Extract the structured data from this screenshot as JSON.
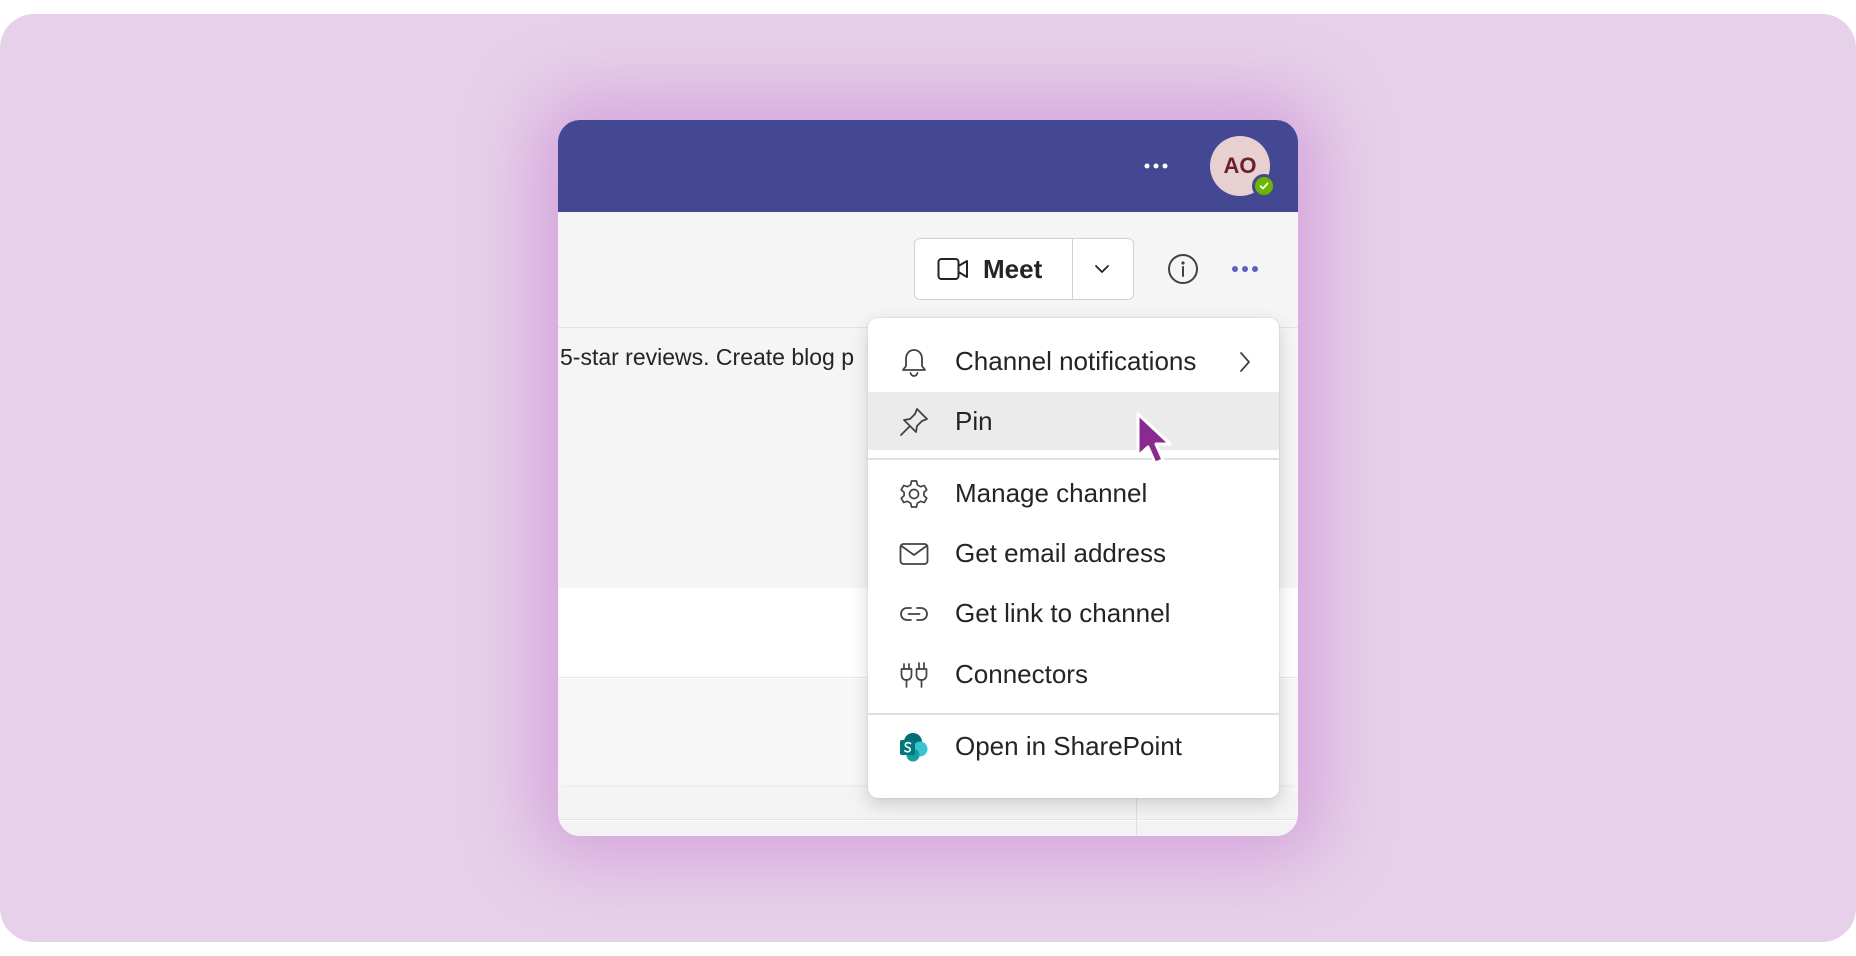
{
  "titlebar": {
    "more_icon": "more-horizontal-icon",
    "avatar_initials": "AO",
    "presence_status": "available",
    "colors": {
      "brand": "#444791",
      "presence": "#6bb700"
    }
  },
  "header": {
    "meet_label": "Meet",
    "meet_icon": "video-camera-icon",
    "dropdown_icon": "chevron-down-icon",
    "info_icon": "info-icon",
    "more_icon": "more-horizontal-icon"
  },
  "message": {
    "text": "5-star reviews. Create blog p"
  },
  "menu": {
    "items": [
      {
        "label": "Channel notifications",
        "icon": "bell-icon",
        "has_submenu": true
      },
      {
        "label": "Pin",
        "icon": "pin-icon",
        "hovered": true
      },
      {
        "label": "Manage channel",
        "icon": "gear-icon"
      },
      {
        "label": "Get email address",
        "icon": "mail-icon"
      },
      {
        "label": "Get link to channel",
        "icon": "link-icon"
      },
      {
        "label": "Connectors",
        "icon": "plug-icon"
      },
      {
        "label": "Open in SharePoint",
        "icon": "sharepoint-icon"
      }
    ]
  },
  "cursor": {
    "icon": "mouse-pointer-icon",
    "color": "#8b2a8e"
  }
}
